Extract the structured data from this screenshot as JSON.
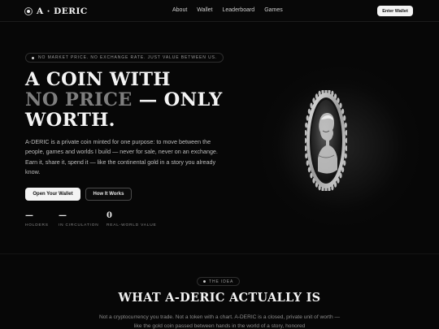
{
  "nav": {
    "logo": "A · DERIC",
    "links": [
      "About",
      "Wallet",
      "Leaderboard",
      "Games"
    ],
    "cta": "Enter Wallet"
  },
  "hero": {
    "badge": "NO MARKET PRICE. NO EXCHANGE RATE. JUST VALUE BETWEEN US.",
    "headline_line1": "A COIN WITH",
    "headline_muted": "NO PRICE",
    "headline_line2_rest": " — ONLY",
    "headline_line3": "WORTH.",
    "lead": "A-DERIC is a private coin minted for one purpose: to move between the people, games and worlds I build — never for sale, never on an exchange. Earn it, share it, spend it — like the continental gold in a story you already know.",
    "primary_button": "Open Your Wallet",
    "secondary_button": "How It Works",
    "stats": [
      {
        "value": "—",
        "label": "HOLDERS"
      },
      {
        "value": "—",
        "label": "IN CIRCULATION"
      },
      {
        "value": "0",
        "label": "REAL-WORLD VALUE"
      }
    ]
  },
  "coin": {
    "icon": "coin-portrait-icon"
  },
  "idea": {
    "badge": "THE IDEA",
    "title": "WHAT A-DERIC ACTUALLY IS",
    "body": "Not a cryptocurrency you trade. Not a token with a chart. A-DERIC is a closed, private unit of worth — like the gold coin passed between hands in the world of a story, honored"
  }
}
